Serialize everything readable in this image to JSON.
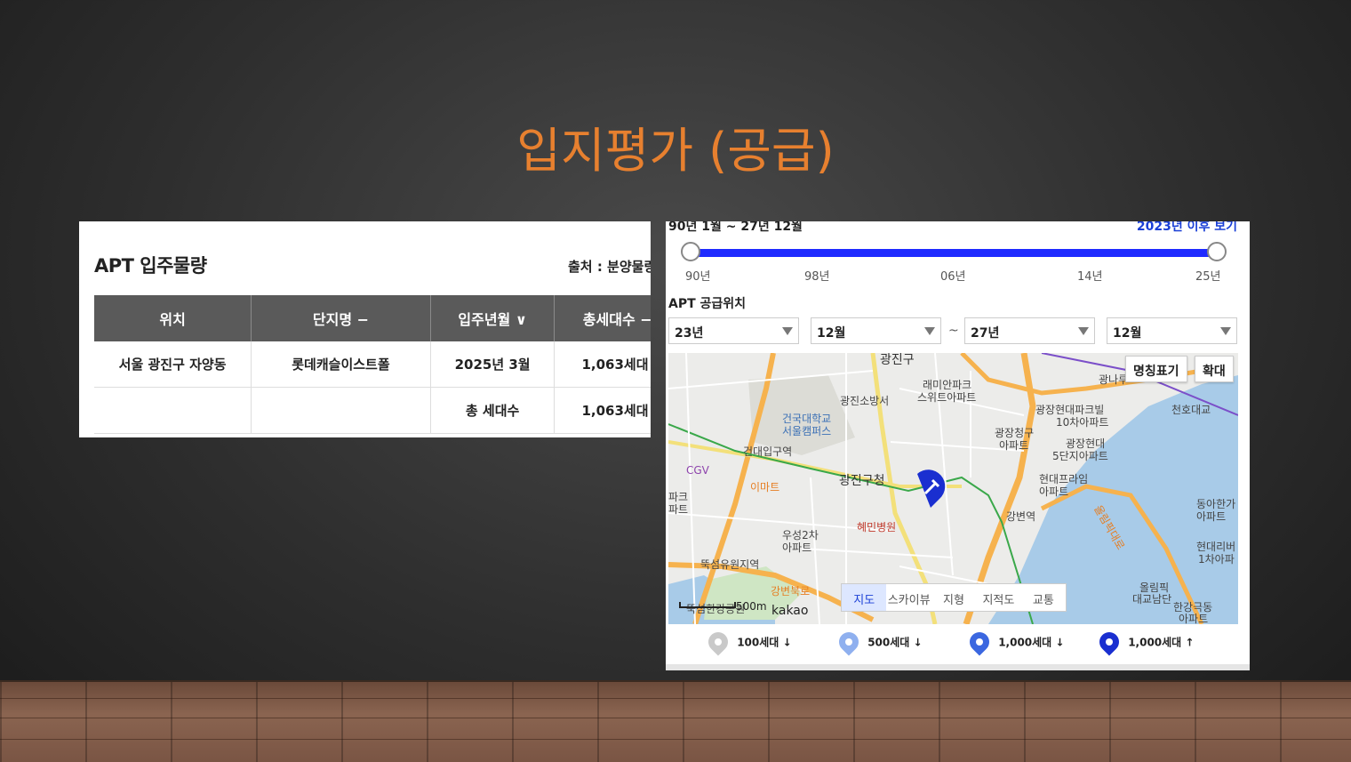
{
  "slide": {
    "title": "입지평가 (공급)"
  },
  "supply_table": {
    "title": "APT 입주물량",
    "source": "출처 : 분양물량코",
    "headers": [
      "위치",
      "단지명 −",
      "입주년월 ∨",
      "총세대수 −"
    ],
    "rows": [
      [
        "서울 광진구 자양동",
        "롯데캐슬이스트폴",
        "2025년 3월",
        "1,063세대"
      ],
      [
        "",
        "",
        "총 세대수",
        "1,063세대"
      ]
    ]
  },
  "supply_map": {
    "range_label": "90년 1월 ~ 27년 12월",
    "after_link": "2023년 이후 보기",
    "slider_ticks": [
      "90년",
      "98년",
      "06년",
      "14년",
      "25년"
    ],
    "section_label": "APT 공급위치",
    "filters": {
      "from_year": "23년",
      "from_month": "12월",
      "separator": "~",
      "to_year": "27년",
      "to_month": "12월"
    },
    "map_buttons": [
      "명칭표기",
      "확대"
    ],
    "map_types": [
      "지도",
      "스카이뷰",
      "지형",
      "지적도",
      "교통"
    ],
    "active_map_type": "지도",
    "scale_label": "500m",
    "attribution": "kakao",
    "map_labels": [
      "광진구",
      "래미안파크",
      "스위트아파트",
      "광진소방서",
      "광나루",
      "건국대학교",
      "서울캠퍼스",
      "광장현대파크빌",
      "10차아파트",
      "광장청구",
      "아파트",
      "광장현대",
      "5단지아파트",
      "천호대교",
      "건대입구역",
      "CGV",
      "이마트",
      "광진구청",
      "현대프라임",
      "아파트",
      "혜민병원",
      "강변역",
      "동아한가",
      "아파트",
      "파크",
      "파트",
      "우성2차",
      "아파트",
      "뚝섬유원지역",
      "현대리버",
      "1차아파",
      "강변북로",
      "올림픽대로",
      "올림픽",
      "대교남단",
      "한강극동",
      "아파트",
      "뚝섬한강공원"
    ],
    "legend": [
      {
        "label": "100세대 ↓",
        "color": "#c9c9c9"
      },
      {
        "label": "500세대 ↓",
        "color": "#8fb0ef"
      },
      {
        "label": "1,000세대 ↓",
        "color": "#3b67e0"
      },
      {
        "label": "1,000세대 ↑",
        "color": "#1a2fd0"
      }
    ]
  }
}
